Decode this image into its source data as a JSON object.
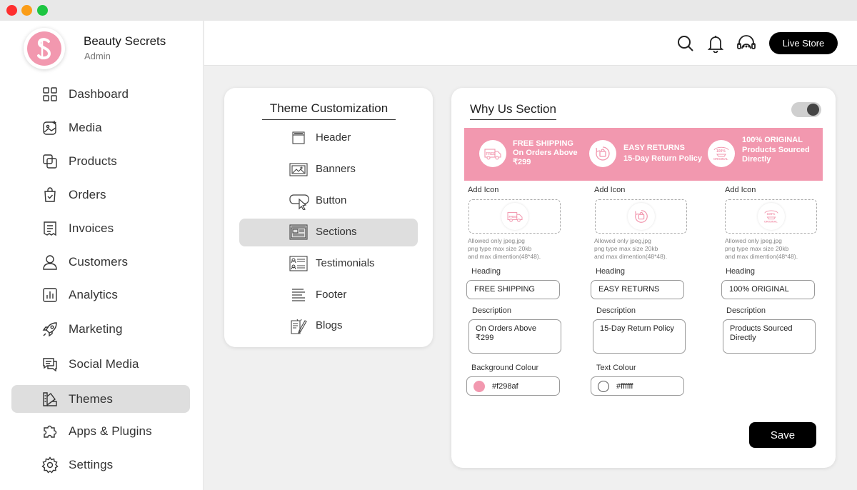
{
  "brand": {
    "name": "Beauty Secrets",
    "role": "Admin"
  },
  "sidebar": {
    "items": [
      {
        "label": "Dashboard",
        "icon": "dashboard-icon"
      },
      {
        "label": "Media",
        "icon": "media-icon"
      },
      {
        "label": "Products",
        "icon": "products-icon"
      },
      {
        "label": "Orders",
        "icon": "orders-icon"
      },
      {
        "label": "Invoices",
        "icon": "invoices-icon"
      },
      {
        "label": "Customers",
        "icon": "customers-icon"
      },
      {
        "label": "Analytics",
        "icon": "analytics-icon"
      },
      {
        "label": "Marketing",
        "icon": "marketing-icon"
      },
      {
        "label": "Social Media",
        "icon": "social-media-icon"
      },
      {
        "label": "Themes",
        "icon": "themes-icon"
      },
      {
        "label": "Apps & Plugins",
        "icon": "plugins-icon"
      },
      {
        "label": "Settings",
        "icon": "settings-icon"
      }
    ],
    "active": "Themes"
  },
  "header": {
    "live_store": "Live Store"
  },
  "theme_customization": {
    "title": "Theme Customization",
    "items": [
      {
        "label": "Header",
        "icon": "header-icon"
      },
      {
        "label": "Banners",
        "icon": "banners-icon"
      },
      {
        "label": "Button",
        "icon": "button-icon"
      },
      {
        "label": "Sections",
        "icon": "sections-icon"
      },
      {
        "label": "Testimonials",
        "icon": "testimonials-icon"
      },
      {
        "label": "Footer",
        "icon": "footer-icon"
      },
      {
        "label": "Blogs",
        "icon": "blogs-icon"
      }
    ],
    "active": "Sections"
  },
  "why_us": {
    "title": "Why Us Section",
    "enabled": true,
    "preview": [
      {
        "heading": "FREE SHIPPING",
        "description": "On Orders Above ₹299",
        "icon": "free-shipping-icon",
        "icon_text": "FREE"
      },
      {
        "heading": "EASY RETURNS",
        "description": "15-Day Return Policy",
        "icon": "easy-returns-icon",
        "icon_text": ""
      },
      {
        "heading": "100% ORIGINAL",
        "description": "Products Sourced Directly",
        "icon": "original-icon",
        "icon_text": "100% ORIGINAL"
      }
    ],
    "add_icon_label": "Add Icon",
    "hint_line1": "Allowed only jpeg,jpg",
    "hint_line2": "png type max size 20kb",
    "hint_line3": "and max dimention(48*48).",
    "heading_label": "Heading",
    "description_label": "Description",
    "columns": [
      {
        "heading": "FREE SHIPPING",
        "description": "On Orders Above ₹299"
      },
      {
        "heading": "EASY RETURNS",
        "description": "15-Day Return Policy"
      },
      {
        "heading": "100% ORIGINAL",
        "description": "Products Sourced Directly"
      }
    ],
    "background_colour_label": "Background Colour",
    "background_colour": "#f298af",
    "text_colour_label": "Text Colour",
    "text_colour": "#ffffff",
    "save_label": "Save"
  },
  "colors": {
    "brand_pink": "#f298af",
    "accent_black": "#000000"
  }
}
